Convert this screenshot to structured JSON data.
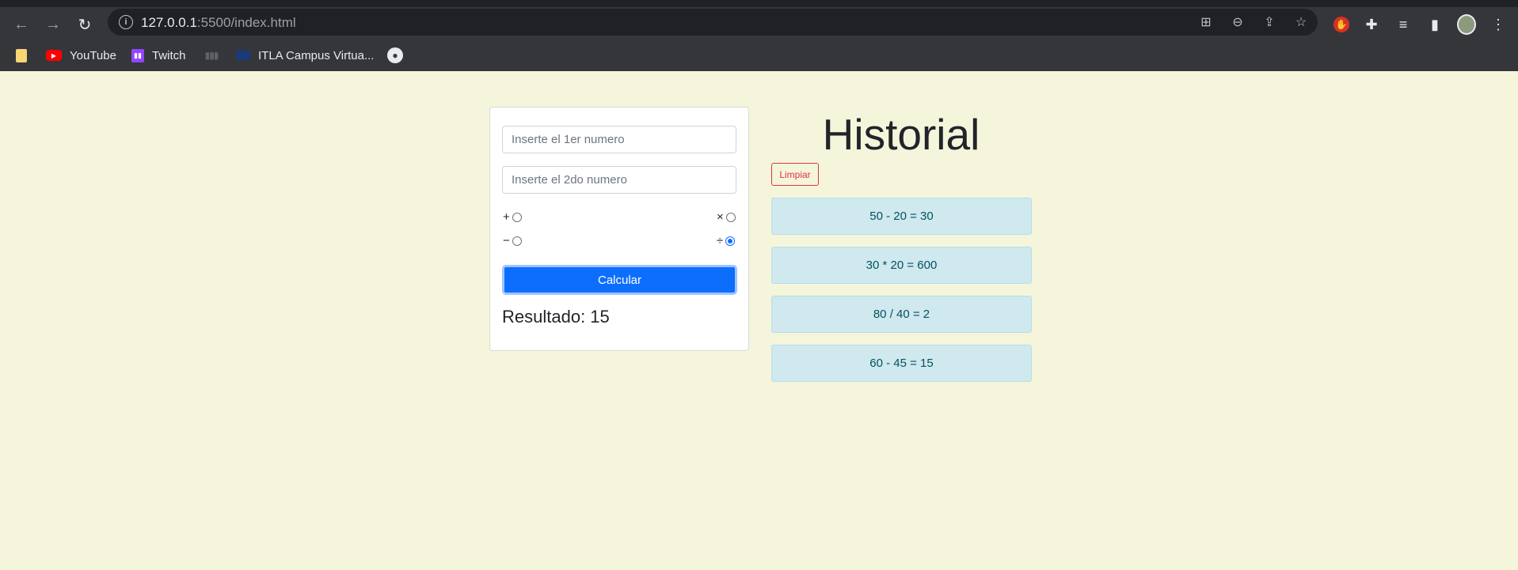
{
  "browser": {
    "url_host": "127.0.0.1",
    "url_rest": ":5500/index.html",
    "bookmarks": [
      {
        "label": "YouTube",
        "icon": "youtube-icon"
      },
      {
        "label": "Twitch",
        "icon": "twitch-icon"
      },
      {
        "label": "ITLA Campus Virtua...",
        "icon": "itla-icon"
      }
    ]
  },
  "calculator": {
    "input1_placeholder": "Inserte el 1er numero",
    "input2_placeholder": "Inserte el 2do numero",
    "ops": {
      "add": "+",
      "multiply": "×",
      "subtract": "−",
      "divide": "÷"
    },
    "selected_op": "divide",
    "calc_label": "Calcular",
    "result_text": "Resultado: 15"
  },
  "history": {
    "title": "Historial",
    "clear_label": "Limpiar",
    "items": [
      "50 - 20 = 30",
      "30 * 20 = 600",
      "80 / 40 = 2",
      "60 - 45 = 15"
    ]
  },
  "colors": {
    "page_bg": "#f5f5dc",
    "primary": "#0d6efd",
    "danger": "#dc3545",
    "history_bg": "#cfe9ee"
  }
}
